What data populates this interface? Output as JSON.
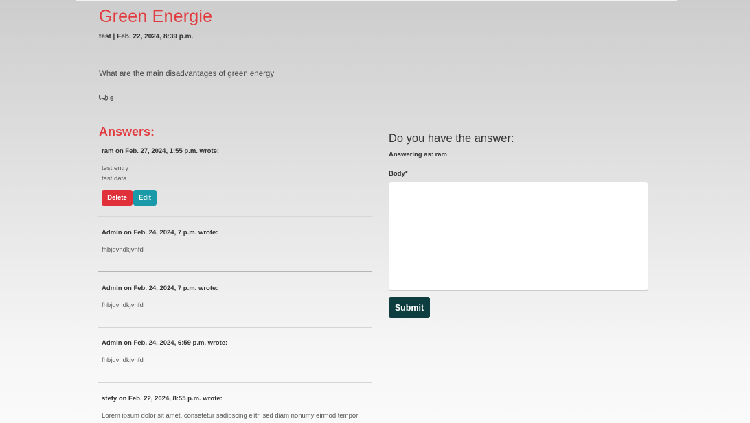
{
  "post": {
    "title": "Green Energie",
    "meta": "test | Feb. 22, 2024, 8:39 p.m.",
    "body": "What are the main disadvantages of green energy",
    "comment_count": "6"
  },
  "answers": {
    "title": "Answers:",
    "items": [
      {
        "header": "ram on Feb. 27, 2024, 1:55 p.m. wrote:",
        "body": "test entry\ntest data"
      },
      {
        "header": "Admin on Feb. 24, 2024, 7 p.m. wrote:",
        "body": "fhbjdvhdkjvnfd"
      },
      {
        "header": "Admin on Feb. 24, 2024, 7 p.m. wrote:",
        "body": "fhbjdvhdkjvnfd"
      },
      {
        "header": "Admin on Feb. 24, 2024, 6:59 p.m. wrote:",
        "body": "fhbjdvhdkjvnfd"
      },
      {
        "header": "stefy on Feb. 22, 2024, 8:55 p.m. wrote:",
        "body": "Lorem ipsum dolor sit amet, consetetur sadipscing elitr, sed diam nonumy eirmod tempor"
      }
    ],
    "delete_label": "Delete",
    "edit_label": "Edit"
  },
  "form": {
    "title": "Do you have the answer:",
    "answering_as": "Answering as: ram",
    "body_label": "Body*",
    "body_value": "",
    "submit_label": "Submit"
  },
  "icons": {
    "comment": "comments-icon"
  },
  "colors": {
    "accent": "#e23b3f",
    "delete": "#e0303a",
    "edit": "#1a9aa9",
    "submit": "#0e3d3f"
  }
}
